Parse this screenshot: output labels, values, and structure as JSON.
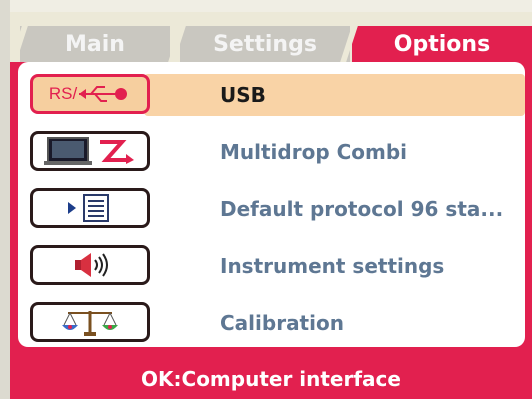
{
  "tabs": [
    {
      "label": "Main",
      "active": false
    },
    {
      "label": "Settings",
      "active": false
    },
    {
      "label": "Options",
      "active": true
    }
  ],
  "menu": {
    "items": [
      {
        "label": "USB",
        "icon": "rs-usb-icon",
        "icon_text": "RS/",
        "selected": true
      },
      {
        "label": "Multidrop Combi",
        "icon": "monitor-dispenser-icon",
        "selected": false
      },
      {
        "label": "Default protocol 96 sta...",
        "icon": "protocol-list-icon",
        "selected": false
      },
      {
        "label": "Instrument settings",
        "icon": "speaker-icon",
        "selected": false
      },
      {
        "label": "Calibration",
        "icon": "balance-scale-icon",
        "selected": false
      }
    ]
  },
  "status_bar": {
    "text": "OK:Computer interface"
  },
  "colors": {
    "accent": "#e2204f",
    "selection": "#f9d3a6",
    "inactive_tab": "#c9c7c0",
    "item_text": "#5e7793"
  }
}
